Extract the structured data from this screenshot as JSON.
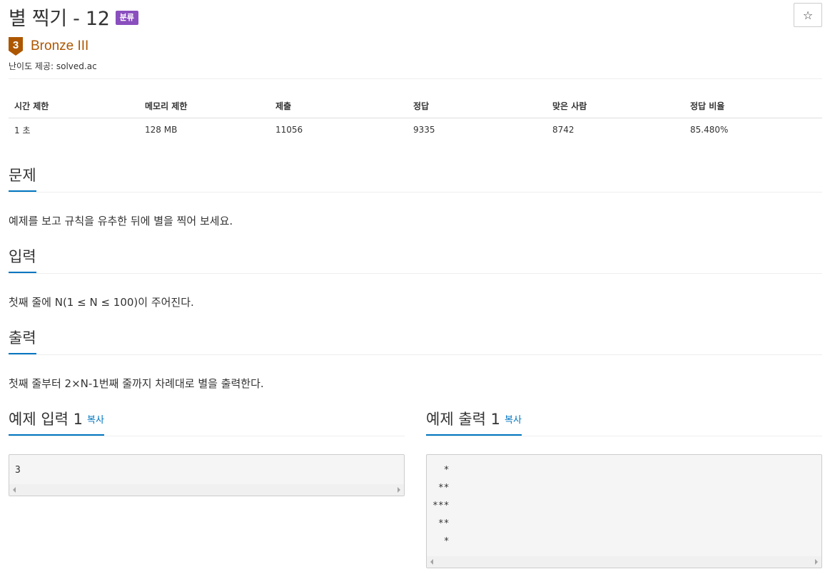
{
  "problem": {
    "title": "별 찍기 - 12",
    "category_badge": "분류",
    "star_icon": "☆"
  },
  "tier": {
    "number": "3",
    "name": "Bronze III",
    "color": "#ad5600",
    "provider": "난이도 제공: solved.ac"
  },
  "info_table": {
    "headers": [
      "시간 제한",
      "메모리 제한",
      "제출",
      "정답",
      "맞은 사람",
      "정답 비율"
    ],
    "values": [
      "1 초",
      "128 MB",
      "11056",
      "9335",
      "8742",
      "85.480%"
    ]
  },
  "sections": {
    "problem": {
      "heading": "문제",
      "text": "예제를 보고 규칙을 유추한 뒤에 별을 찍어 보세요."
    },
    "input": {
      "heading": "입력",
      "text": "첫째 줄에 N(1 ≤ N ≤ 100)이 주어진다."
    },
    "output": {
      "heading": "출력",
      "text": "첫째 줄부터 2×N-1번째 줄까지 차례대로 별을 출력한다."
    }
  },
  "examples": {
    "input": {
      "heading": "예제 입력 1",
      "copy": "복사",
      "content": "3"
    },
    "output": {
      "heading": "예제 출력 1",
      "copy": "복사",
      "content": "  *\n **\n***\n **\n  *"
    }
  },
  "colors": {
    "badge": "#8a4fbe",
    "accent": "#0076c0"
  }
}
